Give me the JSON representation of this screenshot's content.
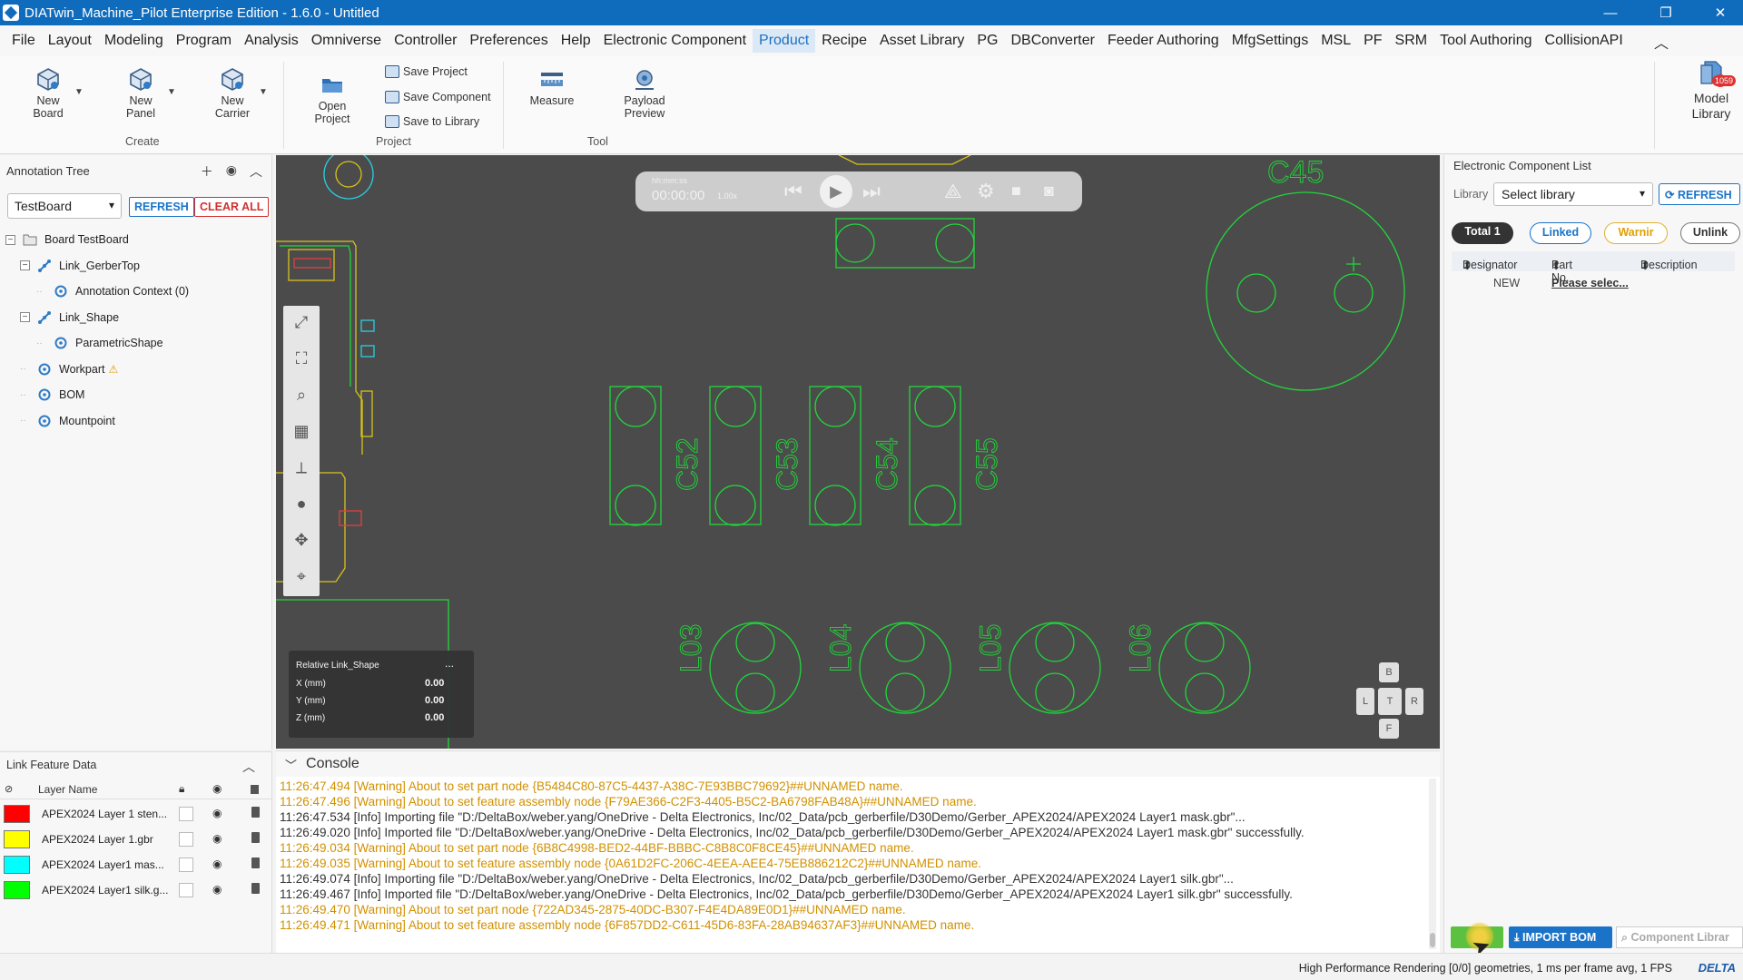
{
  "window": {
    "title": "DIATwin_Machine_Pilot Enterprise Edition - 1.6.0 - Untitled"
  },
  "menu": [
    "File",
    "Layout",
    "Modeling",
    "Program",
    "Analysis",
    "Omniverse",
    "Controller",
    "Preferences",
    "Help",
    "Electronic Component",
    "Product",
    "Recipe",
    "Asset Library",
    "PG",
    "DBConverter",
    "Feeder Authoring",
    "MfgSettings",
    "MSL",
    "PF",
    "SRM",
    "Tool Authoring",
    "CollisionAPI"
  ],
  "menu_active": "Product",
  "ribbon": {
    "new_board": "New Board",
    "new_panel": "New Panel",
    "new_carrier": "New Carrier",
    "create_group": "Create",
    "open_project": "Open Project",
    "save_project": "Save Project",
    "save_component": "Save Component",
    "save_to_library": "Save to Library",
    "project_group": "Project",
    "measure": "Measure",
    "payload_preview": "Payload Preview",
    "tool_group": "Tool",
    "model_library": "Model Library",
    "model_library_badge": "1059"
  },
  "annotation_tree": {
    "title": "Annotation Tree",
    "board_select": "TestBoard",
    "refresh": "REFRESH",
    "clear_all": "CLEAR ALL",
    "nodes": [
      {
        "label": "Board  TestBoard",
        "level": 0,
        "toggle": "−",
        "icon": "folder-icon"
      },
      {
        "label": "Link_GerberTop",
        "level": 1,
        "toggle": "−",
        "icon": "link-icon"
      },
      {
        "label": "Annotation Context (0)",
        "level": 2,
        "toggle": "",
        "icon": "gear-node-icon"
      },
      {
        "label": "Link_Shape",
        "level": 1,
        "toggle": "−",
        "icon": "link-icon"
      },
      {
        "label": "ParametricShape",
        "level": 2,
        "toggle": "",
        "icon": "gear-node-icon"
      },
      {
        "label": "Workpart",
        "level": 1,
        "toggle": "",
        "icon": "gear-node-icon",
        "warning": true
      },
      {
        "label": "BOM",
        "level": 1,
        "toggle": "",
        "icon": "gear-node-icon"
      },
      {
        "label": "Mountpoint",
        "level": 1,
        "toggle": "",
        "icon": "gear-node-icon"
      }
    ]
  },
  "link_feature": {
    "title": "Link Feature Data",
    "col_layer": "Layer Name",
    "layers": [
      {
        "name": "APEX2024 Layer 1 sten...",
        "color": "#ff0000"
      },
      {
        "name": "APEX2024 Layer 1.gbr",
        "color": "#ffff00"
      },
      {
        "name": "APEX2024 Layer1 mas...",
        "color": "#00ffff"
      },
      {
        "name": "APEX2024 Layer1 silk.g...",
        "color": "#00ff00"
      }
    ]
  },
  "viewport": {
    "playback": {
      "time_label": "hh:mm:ss",
      "time": "00:00:00",
      "speed": "1.00x"
    },
    "labels": {
      "c45": "C45",
      "c52": "C52",
      "c53": "C53",
      "c54": "C54",
      "c55": "C55",
      "l03": "L03",
      "l04": "L04",
      "l05": "L05",
      "l06": "L06"
    },
    "coords": {
      "title": "Relative Link_Shape",
      "more": "...",
      "x_label": "X (mm)",
      "y_label": "Y (mm)",
      "z_label": "Z (mm)",
      "x": "0.00",
      "y": "0.00",
      "z": "0.00"
    },
    "nav": {
      "b": "B",
      "l": "L",
      "t": "T",
      "r": "R",
      "f": "F"
    }
  },
  "console": {
    "title": "Console",
    "lines": [
      {
        "level": "warning",
        "text": "11:26:47.494 [Warning] About to set part node {B5484C80-87C5-4437-A38C-7E93BBC79692}##UNNAMED name."
      },
      {
        "level": "warning",
        "text": "11:26:47.496 [Warning] About to set feature assembly node {F79AE366-C2F3-4405-B5C2-BA6798FAB48A}##UNNAMED name."
      },
      {
        "level": "info",
        "text": "11:26:47.534 [Info] Importing file \"D:/DeltaBox/weber.yang/OneDrive - Delta Electronics, Inc/02_Data/pcb_gerberfile/D30Demo/Gerber_APEX2024/APEX2024 Layer1 mask.gbr\"..."
      },
      {
        "level": "info",
        "text": "11:26:49.020 [Info] Imported file \"D:/DeltaBox/weber.yang/OneDrive - Delta Electronics, Inc/02_Data/pcb_gerberfile/D30Demo/Gerber_APEX2024/APEX2024 Layer1 mask.gbr\" successfully."
      },
      {
        "level": "warning",
        "text": "11:26:49.034 [Warning] About to set part node {6B8C4998-BED2-44BF-BBBC-C8B8C0F8CE45}##UNNAMED name."
      },
      {
        "level": "warning",
        "text": "11:26:49.035 [Warning] About to set feature assembly node {0A61D2FC-206C-4EEA-AEE4-75EB886212C2}##UNNAMED name."
      },
      {
        "level": "info",
        "text": "11:26:49.074 [Info] Importing file \"D:/DeltaBox/weber.yang/OneDrive - Delta Electronics, Inc/02_Data/pcb_gerberfile/D30Demo/Gerber_APEX2024/APEX2024 Layer1 silk.gbr\"..."
      },
      {
        "level": "info",
        "text": "11:26:49.467 [Info] Imported file \"D:/DeltaBox/weber.yang/OneDrive - Delta Electronics, Inc/02_Data/pcb_gerberfile/D30Demo/Gerber_APEX2024/APEX2024 Layer1 silk.gbr\" successfully."
      },
      {
        "level": "warning",
        "text": "11:26:49.470 [Warning] About to set part node {722AD345-2875-40DC-B307-F4E4DA89E0D1}##UNNAMED name."
      },
      {
        "level": "warning",
        "text": "11:26:49.471 [Warning] About to set feature assembly node {6F857DD2-C611-45D6-83FA-28AB94637AF3}##UNNAMED name."
      }
    ]
  },
  "component_list": {
    "title": "Electronic Component List",
    "library_label": "Library",
    "library_select": "Select library",
    "refresh": "REFRESH",
    "filters": {
      "total": "Total 1",
      "linked": "Linked",
      "warning": "Warnir",
      "unlink": "Unlink"
    },
    "columns": {
      "designator": "Designator",
      "part_no": "Part No.",
      "description": "Description"
    },
    "rows": [
      {
        "designator": "NEW",
        "part_no": "Please selec..."
      }
    ],
    "import_bom": "IMPORT BOM",
    "component_library": "Component Librar"
  },
  "status": {
    "text": "High Performance Rendering [0/0] geometries, 1 ms per frame avg, 1 FPS",
    "logo": "DELTA"
  },
  "colors": {
    "accent": "#0f6cbd",
    "pcb_green": "#22d63a",
    "pcb_yellow": "#d8c21c",
    "pcb_cyan": "#2ad0e0",
    "warning": "#d29000"
  }
}
